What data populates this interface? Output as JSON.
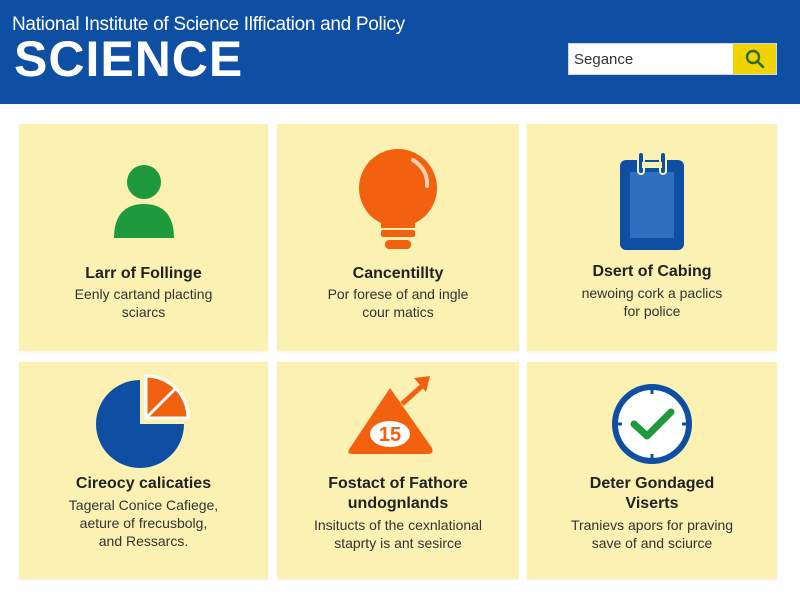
{
  "header": {
    "org_name": "National Institute of Science Ilffication and Policy",
    "brand": "SCIENCE",
    "background": "#0f4fa3"
  },
  "search": {
    "value": "Segance",
    "button_icon": "search-icon",
    "button_color": "#f1d300"
  },
  "cards": [
    {
      "icon": "person-icon",
      "icon_color": "#1e9a3d",
      "title": [
        "Larr of Follinge"
      ],
      "description": [
        "Eenly cartand placting",
        "sciarcs"
      ]
    },
    {
      "icon": "lightbulb-icon",
      "icon_color": "#f2610f",
      "title": [
        "Cancentillty"
      ],
      "description": [
        "Por forese of and ingle",
        "cour matics"
      ]
    },
    {
      "icon": "clipboard-icon",
      "icon_color": "#0f4fa3",
      "title": [
        "Dsert of Cabing"
      ],
      "description": [
        "newoing cork a paclics",
        "for police"
      ]
    },
    {
      "icon": "pie-chart-icon",
      "icon_color": "#0f4fa3",
      "title": [
        "Cireocy calicaties"
      ],
      "description": [
        "Tageral Conice Cafiege,",
        "aeture of frecusbolg,",
        "and Ressarcs."
      ]
    },
    {
      "icon": "triangle-arrow-icon",
      "icon_color": "#f2610f",
      "icon_label": "15",
      "title": [
        "Fostact of Fathore",
        "undognlands"
      ],
      "description": [
        "Insitucts of the cexnlational",
        "staprty is ant sesirce"
      ]
    },
    {
      "icon": "check-circle-icon",
      "icon_color": "#1e9a3d",
      "title": [
        "Deter Gondaged",
        "Viserts"
      ],
      "description": [
        "Tranievs apors for praving",
        "save of and sciurce"
      ]
    }
  ]
}
